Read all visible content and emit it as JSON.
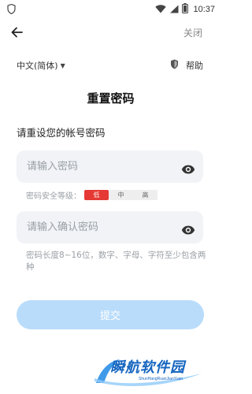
{
  "status_bar": {
    "time": "10:37"
  },
  "header": {
    "close_label": "关闭"
  },
  "language": {
    "selected": "中文(简体)"
  },
  "help": {
    "label": "帮助"
  },
  "page": {
    "title": "重置密码",
    "subtitle": "请重设您的帐号密码"
  },
  "password": {
    "placeholder": "请输入密码"
  },
  "strength": {
    "label": "密码安全等级：",
    "levels": [
      "低",
      "中",
      "高"
    ],
    "active_level": "低",
    "active_color": "#e53935"
  },
  "confirm": {
    "placeholder": "请输入确认密码"
  },
  "hint": "密码长度8~16位，数字、字母、字符至少包含两种",
  "submit": {
    "label": "提交",
    "color": "#b9dcfb"
  },
  "watermark": {
    "title": "瞬航软件园",
    "subtitle": "ShunHangRuanJianYuan"
  }
}
